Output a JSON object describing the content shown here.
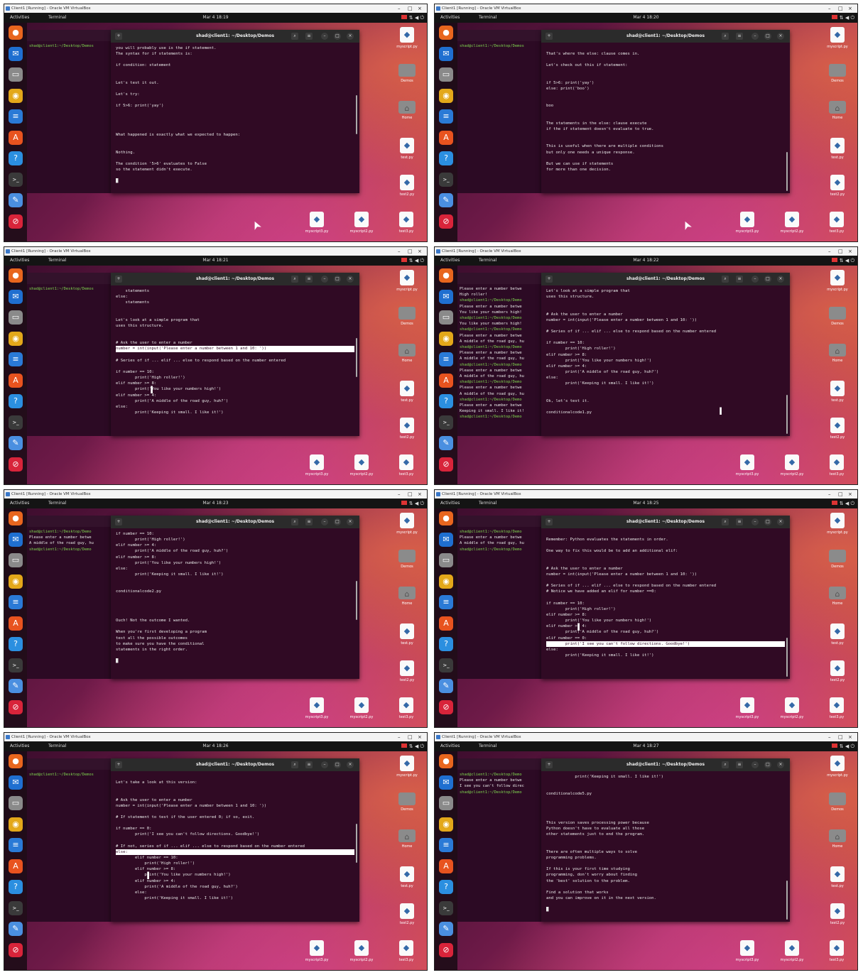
{
  "window": {
    "vm_title": "Client1 [Running] - Oracle VM VirtualBox",
    "activities": "Activities",
    "app_label": "Terminal",
    "term_title": "shad@client1: ~/Desktop/Demos",
    "controls": {
      "minimize": "–",
      "maximize": "□",
      "close": "×"
    }
  },
  "desktop_icons": [
    {
      "label": "myscript.py",
      "kind": "python"
    },
    {
      "label": "Demos",
      "kind": "folder"
    },
    {
      "label": "Home",
      "kind": "home"
    },
    {
      "label": "test.py",
      "kind": "python"
    },
    {
      "label": "test2.py",
      "kind": "python"
    }
  ],
  "bottom_icons": [
    {
      "label": "myscript3.py"
    },
    {
      "label": "myscript2.py"
    },
    {
      "label": "test3.py"
    }
  ],
  "dock_icons": [
    {
      "name": "firefox-icon",
      "color": "#e8661e",
      "glyph": "●"
    },
    {
      "name": "thunderbird-icon",
      "color": "#1f6fd0",
      "glyph": "✉"
    },
    {
      "name": "files-icon",
      "color": "#8a8a8a",
      "glyph": "▭"
    },
    {
      "name": "rhythmbox-icon",
      "color": "#e3a81a",
      "glyph": "◉"
    },
    {
      "name": "writer-icon",
      "color": "#2a7ad6",
      "glyph": "≡"
    },
    {
      "name": "software-icon",
      "color": "#e8531f",
      "glyph": "A"
    },
    {
      "name": "help-icon",
      "color": "#2b8fe0",
      "glyph": "?"
    },
    {
      "name": "terminal-icon",
      "color": "#3a3a3a",
      "glyph": ">_"
    },
    {
      "name": "text-editor-icon",
      "color": "#4a8fe0",
      "glyph": "✎"
    },
    {
      "name": "trash-icon",
      "color": "#d8243a",
      "glyph": "⊘"
    }
  ],
  "screens": [
    {
      "clock": "Mar 4 18:19",
      "back_lines": [
        {
          "text": "shad@client1:~/Desktop/Demos",
          "prompt": true
        }
      ],
      "lines": [
        "you will probably use is the if statement.",
        "The syntax for if statements is:",
        "",
        "if condition: statement",
        "",
        "",
        "Let's test it out.",
        "",
        "Let's try:",
        "",
        "if 5>6: print('yay')",
        "",
        "",
        "",
        "",
        "What happened is exactly what we expected to happen:",
        "",
        "",
        "Nothing.",
        "",
        "The condition '5>6' evaluates to False",
        "so the statement didn't execute.",
        "",
        "█"
      ],
      "highlight": [],
      "pointer": "arrow"
    },
    {
      "clock": "Mar 4 18:20",
      "back_lines": [
        {
          "text": "shad@client1:~/Desktop/Demos",
          "prompt": true
        }
      ],
      "lines": [
        "",
        "That's where the else: clause comes in.",
        "",
        "Let's check out this if statement:",
        "",
        "",
        "if 5>6: print('yay')",
        "else: print('boo')",
        "",
        "",
        "boo",
        "",
        "",
        "The statements in the else: clause execute",
        "if the if statement doesn't evaluate to true.",
        "",
        "",
        "This is useful when there are multiple conditions",
        "but only one needs a unique response.",
        "",
        "But we can use if statements",
        "for more than one decision."
      ],
      "highlight": [],
      "pointer": "arrow"
    },
    {
      "clock": "Mar 4 18:21",
      "back_lines": [
        {
          "text": "shad@client1:~/Desktop/Demos",
          "prompt": true
        }
      ],
      "lines": [
        "    statements",
        "else:",
        "    statements",
        "",
        "",
        "Let's look at a simple program that",
        "uses this structure.",
        "",
        "",
        "# Ask the user to enter a number",
        "number = int(input('Please enter a number between 1 and 10: '))",
        "",
        "# Series of if ... elif ... else to respond based on the number entered",
        "",
        "if number == 10:",
        "        print('High roller!')",
        "elif number >= 8:",
        "        print('You like your numbers high!')",
        "elif number >= 4:",
        "        print('A middle of the road guy, huh?')",
        "else:",
        "        print('Keeping it small. I like it!')"
      ],
      "highlight": [
        10
      ],
      "pointer": "ibeam"
    },
    {
      "clock": "Mar 4 18:22",
      "back_lines": [
        {
          "text": "Please enter a number betwe",
          "prompt": false
        },
        {
          "text": "High roller!",
          "prompt": false
        },
        {
          "text": "shad@client1:~/Desktop/Demo",
          "prompt": true
        },
        {
          "text": "Please enter a number betwe",
          "prompt": false
        },
        {
          "text": "You like your numbers high!",
          "prompt": false
        },
        {
          "text": "shad@client1:~/Desktop/Demo",
          "prompt": true
        },
        {
          "text": "You like your numbers high!",
          "prompt": false
        },
        {
          "text": "shad@client1:~/Desktop/Demo",
          "prompt": true
        },
        {
          "text": "Please enter a number betwe",
          "prompt": false
        },
        {
          "text": "A middle of the road guy, hu",
          "prompt": false
        },
        {
          "text": "shad@client1:~/Desktop/Demo",
          "prompt": true
        },
        {
          "text": "Please enter a number betwe",
          "prompt": false
        },
        {
          "text": "A middle of the road guy, hu",
          "prompt": false
        },
        {
          "text": "shad@client1:~/Desktop/Demo",
          "prompt": true
        },
        {
          "text": "Please enter a number betwe",
          "prompt": false
        },
        {
          "text": "A middle of the road guy, hu",
          "prompt": false
        },
        {
          "text": "shad@client1:~/Desktop/Demo",
          "prompt": true
        },
        {
          "text": "Please enter a number betwe",
          "prompt": false
        },
        {
          "text": "A middle of the road guy, hu",
          "prompt": false
        },
        {
          "text": "shad@client1:~/Desktop/Demo",
          "prompt": true
        },
        {
          "text": "Please enter a number betwe",
          "prompt": false
        },
        {
          "text": "Keeping it small. I like it!",
          "prompt": false
        },
        {
          "text": "shad@client1:~/Desktop/Demo",
          "prompt": true
        }
      ],
      "lines": [
        "Let's look at a simple program that",
        "uses this structure.",
        "",
        "",
        "# Ask the user to enter a number",
        "number = int(input('Please enter a number between 1 and 10: '))",
        "",
        "# Series of if ... elif ... else to respond based on the number entered",
        "",
        "if number == 10:",
        "        print('High roller!')",
        "elif number >= 8:",
        "        print('You like your numbers high!')",
        "elif number >= 4:",
        "        print('A middle of the road guy, huh?')",
        "else:",
        "        print('Keeping it small. I like it!')",
        "",
        "",
        "Ok, let's test it.",
        "",
        "conditionalcode1.py"
      ],
      "highlight": [],
      "pointer": "ibeam"
    },
    {
      "clock": "Mar 4 18:23",
      "back_lines": [
        {
          "text": "shad@client1:~/Desktop/Demo",
          "prompt": true
        },
        {
          "text": "Please enter a number betwe",
          "prompt": false
        },
        {
          "text": "A middle of the road guy, hu",
          "prompt": false
        },
        {
          "text": "shad@client1:~/Desktop/Demo",
          "prompt": true
        }
      ],
      "lines": [
        "if number == 10:",
        "        print('High roller!')",
        "elif number >= 4:",
        "        print('A middle of the road guy, huh?')",
        "elif number >= 8:",
        "        print('You like your numbers high!')",
        "else:",
        "        print('Keeping it small. I like it!')",
        "",
        "",
        "conditionalcode2.py",
        "",
        "",
        "",
        "",
        "Ouch! Not the outcome I wanted.",
        "",
        "When you're first developing a program",
        "test all the possible outcomes",
        "to make sure you have the conditional",
        "statements in the right order.",
        "",
        "█"
      ],
      "highlight": [],
      "pointer": "none"
    },
    {
      "clock": "Mar 4 18:25",
      "back_lines": [
        {
          "text": "shad@client1:~/Desktop/Demo",
          "prompt": true
        },
        {
          "text": "Please enter a number betwe",
          "prompt": false
        },
        {
          "text": "A middle of the road guy, hu",
          "prompt": false
        },
        {
          "text": "shad@client1:~/Desktop/Demo",
          "prompt": true
        }
      ],
      "lines": [
        "",
        "Remember: Python evaluates the statements in order.",
        "",
        "One way to fix this would be to add an additional elif:",
        "",
        "",
        "# Ask the user to enter a number",
        "number = int(input('Please enter a number between 1 and 10: '))",
        "",
        "# Series of if ... elif ... else to respond based on the number entered",
        "# Notice we have added an elif for number ==0:",
        "",
        "if number == 10:",
        "        print('High roller!')",
        "elif number >= 8:",
        "        print('You like your numbers high!')",
        "elif number >= 4:",
        "        print('A middle of the road guy, huh?')",
        "elif number == 0:",
        "        print('I see you can't follow directions. Goodbye!')",
        "else:",
        "        print('Keeping it small. I like it!')"
      ],
      "highlight": [
        19
      ],
      "pointer": "ibeam"
    },
    {
      "clock": "Mar 4 18:26",
      "back_lines": [
        {
          "text": "shad@client1:~/Desktop/Demos",
          "prompt": true
        }
      ],
      "lines": [
        "",
        "Let's take a look at this version:",
        "",
        "",
        "# Ask the user to enter a number",
        "number = int(input('Please enter a number between 1 and 10: '))",
        "",
        "# If statement to test if the user entered 0; if so, exit.",
        "",
        "if number == 0:",
        "        print('I see you can't follow directions. Goodbye!')",
        "",
        "# If not, series of if ... elif ... else to respond based on the number entered",
        "else:",
        "        elif number == 10:",
        "            print('High roller!')",
        "        elif number >= 8:",
        "            print('You like your numbers high!')",
        "        elif number >= 4:",
        "            print('A middle of the road guy, huh?')",
        "        else:",
        "            print('Keeping it small. I like it!')"
      ],
      "highlight": [
        13
      ],
      "pointer": "ibeam"
    },
    {
      "clock": "Mar 4 18:27",
      "back_lines": [
        {
          "text": "shad@client1:~/Desktop/Demo",
          "prompt": true
        },
        {
          "text": "Please enter a number betwe",
          "prompt": false
        },
        {
          "text": "I see you can't follow direc",
          "prompt": false
        },
        {
          "text": "shad@client1:~/Desktop/Demo",
          "prompt": true
        }
      ],
      "lines": [
        "            print('Keeping it small. I like it!')",
        "",
        "",
        "conditionalcode5.py",
        "",
        "",
        "",
        "",
        "This version saves processing power because",
        "Python doesn't have to evaluate all those",
        "other statements just to end the program.",
        "",
        "",
        "There are often multiple ways to solve",
        "programming problems.",
        "",
        "If this is your first time studying",
        "programming, don't worry about finding",
        "the 'best' solution to the problem.",
        "",
        "Find a solution that works",
        "and you can improve on it in the next version.",
        "",
        "█"
      ],
      "highlight": [],
      "pointer": "none"
    }
  ]
}
